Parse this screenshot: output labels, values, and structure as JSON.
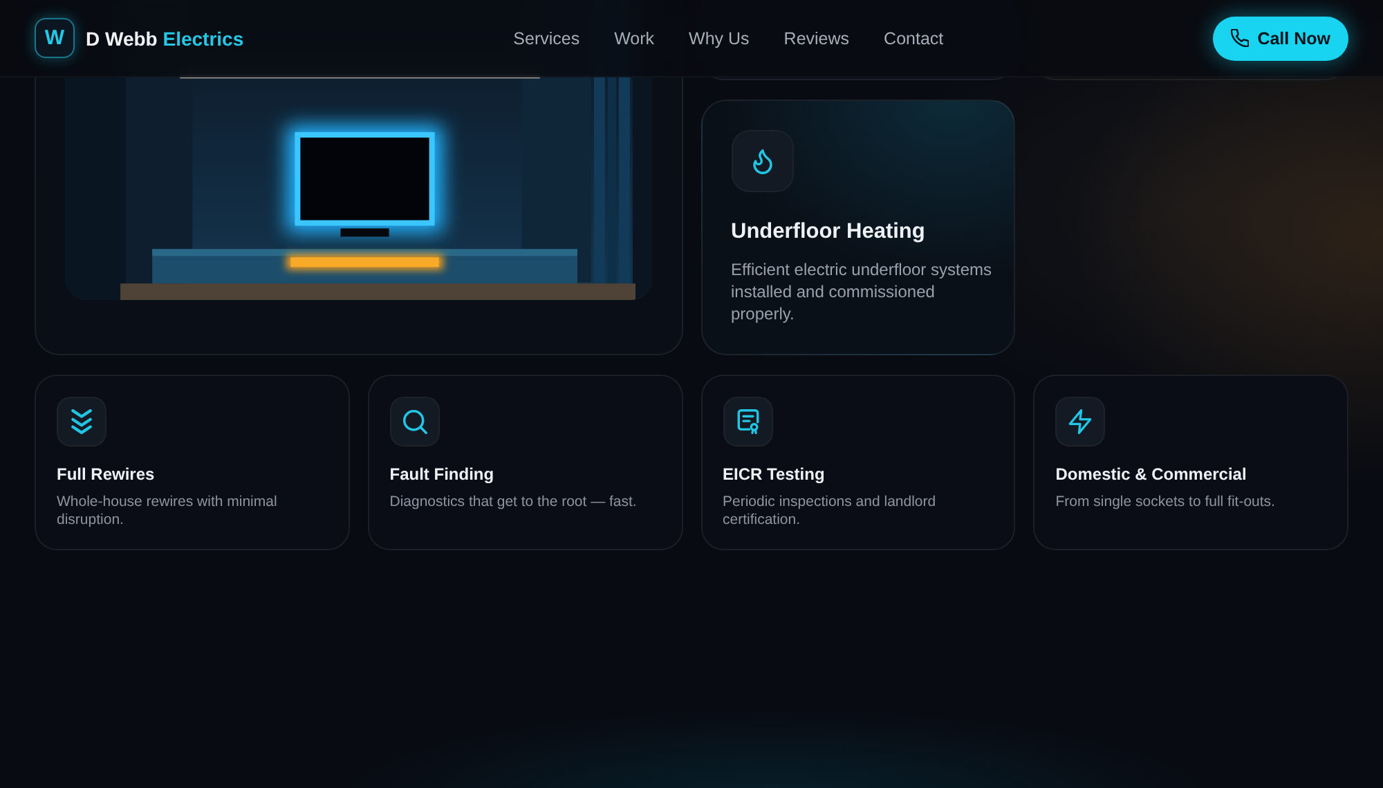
{
  "header": {
    "logo_letter": "W",
    "brand": {
      "name": "D Webb",
      "highlight": "Electrics"
    },
    "nav": [
      {
        "label": "Services"
      },
      {
        "label": "Work"
      },
      {
        "label": "Why Us"
      },
      {
        "label": "Reviews"
      },
      {
        "label": "Contact"
      }
    ],
    "cta": {
      "label": "Call Now"
    }
  },
  "featured_service": {
    "title": "Underfloor Heating",
    "description": "Efficient electric underfloor systems installed and commissioned properly."
  },
  "services": [
    {
      "title": "Full Rewires",
      "description": "Whole-house rewires with minimal disruption."
    },
    {
      "title": "Fault Finding",
      "description": "Diagnostics that get to the root — fast."
    },
    {
      "title": "EICR Testing",
      "description": "Periodic inspections and landlord certification."
    },
    {
      "title": "Domestic & Commercial",
      "description": "From single sockets to full fit-outs."
    }
  ]
}
